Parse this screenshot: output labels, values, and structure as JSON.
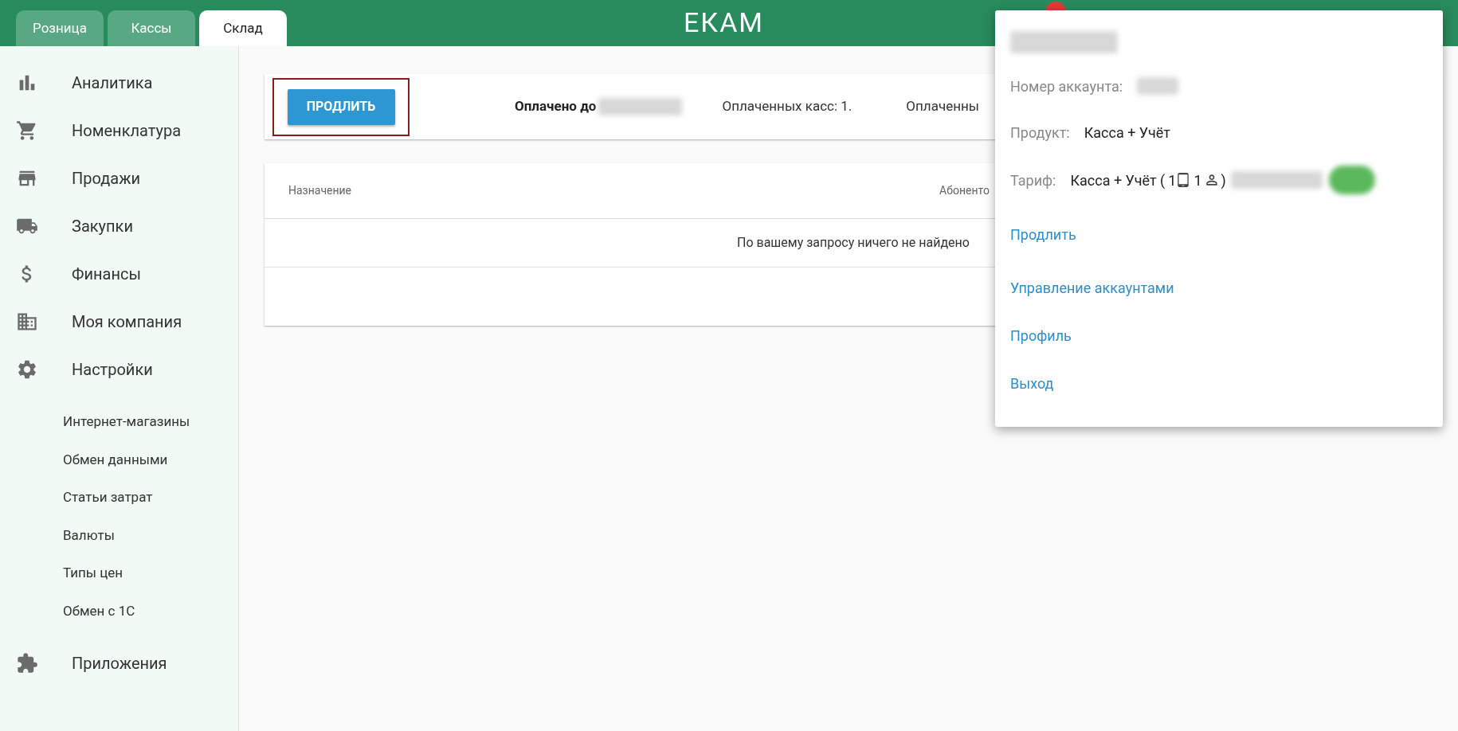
{
  "header": {
    "tabs": [
      {
        "label": "Розница",
        "selected": false
      },
      {
        "label": "Кассы",
        "selected": false
      },
      {
        "label": "Склад",
        "selected": true
      }
    ],
    "logo": "ЕКАМ"
  },
  "sidebar": {
    "items": [
      {
        "label": "Аналитика"
      },
      {
        "label": "Номенклатура"
      },
      {
        "label": "Продажи"
      },
      {
        "label": "Закупки"
      },
      {
        "label": "Финансы"
      },
      {
        "label": "Моя компания"
      },
      {
        "label": "Настройки",
        "children": [
          {
            "label": "Интернет-магазины"
          },
          {
            "label": "Обмен данными"
          },
          {
            "label": "Статьи затрат"
          },
          {
            "label": "Валюты"
          },
          {
            "label": "Типы цен"
          },
          {
            "label": "Обмен с 1С"
          }
        ]
      },
      {
        "label": "Приложения"
      }
    ]
  },
  "subscription_bar": {
    "button": "ПРОДЛИТЬ",
    "paid_until": "Оплачено до",
    "paid_registers": "Оплаченных касс: 1.",
    "column_3": "Оплаченны"
  },
  "table": {
    "columns": [
      "Назначение",
      "Абоненто"
    ],
    "empty_message": "По вашему запросу ничего не найдено"
  },
  "account_menu": {
    "account_number_label": "Номер аккаунта:",
    "product_label": "Продукт:",
    "product": "Касса + Учёт",
    "tariff_label": "Тариф:",
    "tariff": {
      "name": "Касса + Учёт (",
      "registers": "1",
      "users": "1",
      "close": ")"
    },
    "renew_link": "Продлить",
    "links": [
      "Управление аккаунтами",
      "Профиль",
      "Выход"
    ]
  }
}
